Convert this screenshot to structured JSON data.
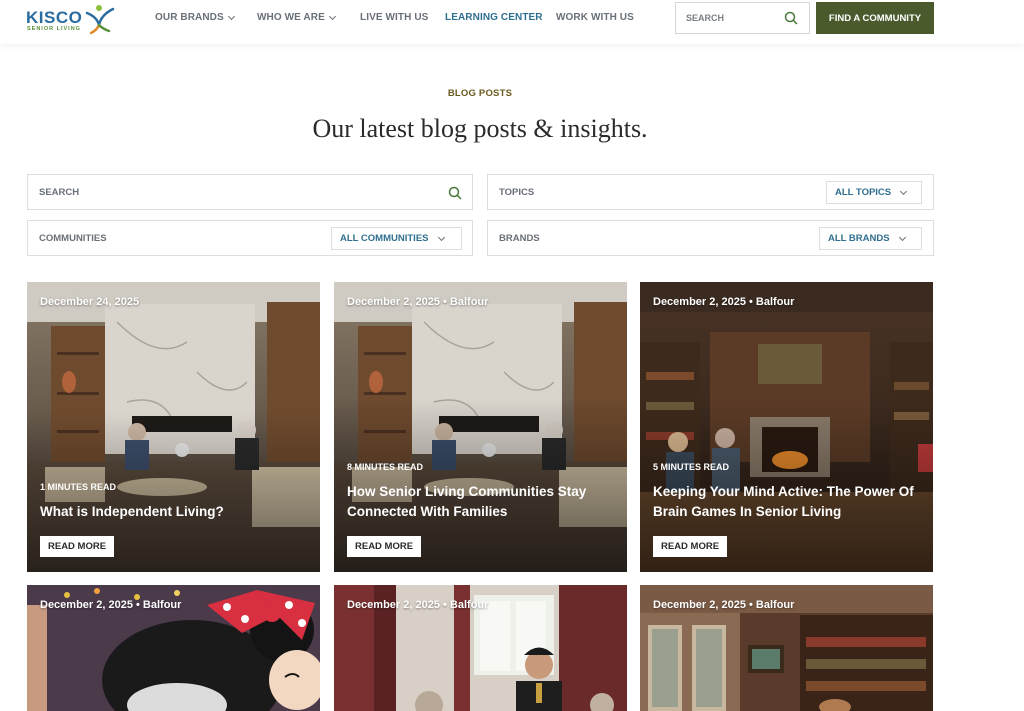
{
  "header": {
    "logo_text": "KISCO",
    "logo_sub": "SENIOR LIVING",
    "nav": [
      {
        "label": "OUR BRANDS",
        "dropdown": true
      },
      {
        "label": "WHO WE ARE",
        "dropdown": true
      },
      {
        "label": "LIVE WITH US",
        "dropdown": false
      },
      {
        "label": "LEARNING CENTER",
        "dropdown": false
      },
      {
        "label": "WORK WITH US",
        "dropdown": false
      }
    ],
    "search_placeholder": "SEARCH",
    "cta_label": "FIND A COMMUNITY"
  },
  "intro": {
    "eyebrow": "BLOG POSTS",
    "headline": "Our latest blog posts & insights."
  },
  "filters": {
    "search_label": "SEARCH",
    "topics_label": "TOPICS",
    "topics_value": "ALL TOPICS",
    "communities_label": "COMMUNITIES",
    "communities_value": "ALL COMMUNITIES",
    "brands_label": "BRANDS",
    "brands_value": "ALL BRANDS"
  },
  "cards": [
    {
      "date": "December 24, 2025",
      "read_time": "1 MINUTES READ",
      "title": "What is Independent Living?",
      "cta": "READ MORE",
      "image": "living-room-fireplace"
    },
    {
      "date": "December 2, 2025 • Balfour",
      "read_time": "8 MINUTES READ",
      "title": "How Senior Living Communities Stay Connected With Families",
      "cta": "READ MORE",
      "image": "living-room-fireplace"
    },
    {
      "date": "December 2, 2025 • Balfour",
      "read_time": "5 MINUTES READ",
      "title": "Keeping Your Mind Active: The Power Of Brain Games In Senior Living",
      "cta": "READ MORE",
      "image": "library-fireplace"
    },
    {
      "date": "December 2, 2025 • Balfour",
      "image": "mascot-minnie"
    },
    {
      "date": "December 2, 2025 • Balfour",
      "image": "dining-server"
    },
    {
      "date": "December 2, 2025 • Balfour",
      "image": "library-room"
    }
  ],
  "colors": {
    "brand_blue": "#2a6ca0",
    "brand_green": "#4a5a2c",
    "link_blue": "#2f6f90",
    "eyebrow_gold": "#6b5a1e"
  }
}
